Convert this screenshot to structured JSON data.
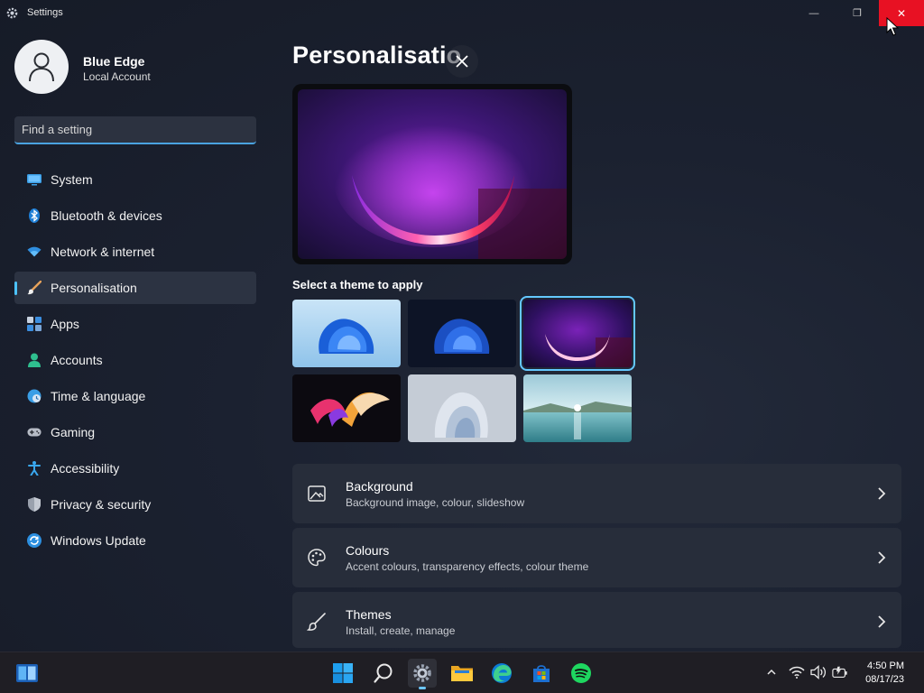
{
  "window": {
    "title": "Settings",
    "controls": {
      "minimize": "—",
      "maximize": "❐",
      "close": "✕"
    }
  },
  "profile": {
    "name": "Blue Edge",
    "account_type": "Local Account"
  },
  "search": {
    "placeholder": "Find a setting"
  },
  "nav": {
    "items": [
      {
        "label": "System",
        "icon": "system-icon"
      },
      {
        "label": "Bluetooth & devices",
        "icon": "bluetooth-icon"
      },
      {
        "label": "Network & internet",
        "icon": "wifi-icon"
      },
      {
        "label": "Personalisation",
        "icon": "brush-icon",
        "active": true
      },
      {
        "label": "Apps",
        "icon": "apps-icon"
      },
      {
        "label": "Accounts",
        "icon": "accounts-icon"
      },
      {
        "label": "Time & language",
        "icon": "clock-globe-icon"
      },
      {
        "label": "Gaming",
        "icon": "gamepad-icon"
      },
      {
        "label": "Accessibility",
        "icon": "accessibility-icon"
      },
      {
        "label": "Privacy & security",
        "icon": "shield-icon"
      },
      {
        "label": "Windows Update",
        "icon": "update-icon"
      }
    ]
  },
  "main": {
    "page_title": "Personalisatio",
    "theme_heading": "Select a theme to apply",
    "themes": [
      {
        "name": "light-bloom",
        "selected": false
      },
      {
        "name": "dark-bloom",
        "selected": false
      },
      {
        "name": "glow-arc",
        "selected": true
      },
      {
        "name": "captured-motion",
        "selected": false
      },
      {
        "name": "soft-flow",
        "selected": false
      },
      {
        "name": "lake-sunrise",
        "selected": false
      }
    ],
    "cards": [
      {
        "title": "Background",
        "subtitle": "Background image, colour, slideshow",
        "icon": "image-icon"
      },
      {
        "title": "Colours",
        "subtitle": "Accent colours, transparency effects, colour theme",
        "icon": "palette-icon"
      },
      {
        "title": "Themes",
        "subtitle": "Install, create, manage",
        "icon": "brush-icon"
      }
    ]
  },
  "taskbar": {
    "apps": [
      "start",
      "search",
      "settings",
      "file-explorer",
      "edge",
      "store",
      "spotify"
    ],
    "active_app": "settings",
    "tray": [
      "chevron-up-icon",
      "wifi-icon",
      "volume-icon",
      "battery-icon"
    ],
    "time": "4:50 PM",
    "date": "08/17/23"
  },
  "colors": {
    "accent": "#4cc2ff",
    "close_hover": "#e81123",
    "card_bg": "#272d3a",
    "nav_active_bg": "#2c3342"
  }
}
